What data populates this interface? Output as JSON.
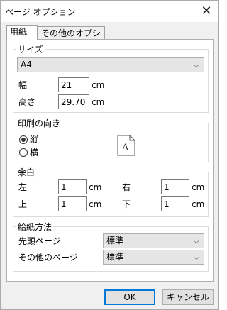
{
  "window": {
    "title": "ページ オプション",
    "close_glyph": "✕"
  },
  "tabs": [
    {
      "label": "用紙",
      "active": true
    },
    {
      "label": "その他のオプション",
      "active": false
    }
  ],
  "size_group": {
    "title": "サイズ",
    "selected_size": "A4",
    "width_label": "幅",
    "width_value": "21",
    "height_label": "高さ",
    "height_value": "29.70",
    "unit": "cm"
  },
  "orientation_group": {
    "title": "印刷の向き",
    "portrait_label": "縦",
    "landscape_label": "横",
    "selected": "portrait",
    "page_icon_letter": "A"
  },
  "margins_group": {
    "title": "余白",
    "left_label": "左",
    "left_value": "1",
    "right_label": "右",
    "right_value": "1",
    "top_label": "上",
    "top_value": "1",
    "bottom_label": "下",
    "bottom_value": "1",
    "unit": "cm"
  },
  "paper_feed_group": {
    "title": "給紙方法",
    "first_page_label": "先頭ページ",
    "first_page_value": "標準",
    "other_pages_label": "その他のページ",
    "other_pages_value": "標準"
  },
  "buttons": {
    "ok": "OK",
    "cancel": "キャンセル"
  }
}
